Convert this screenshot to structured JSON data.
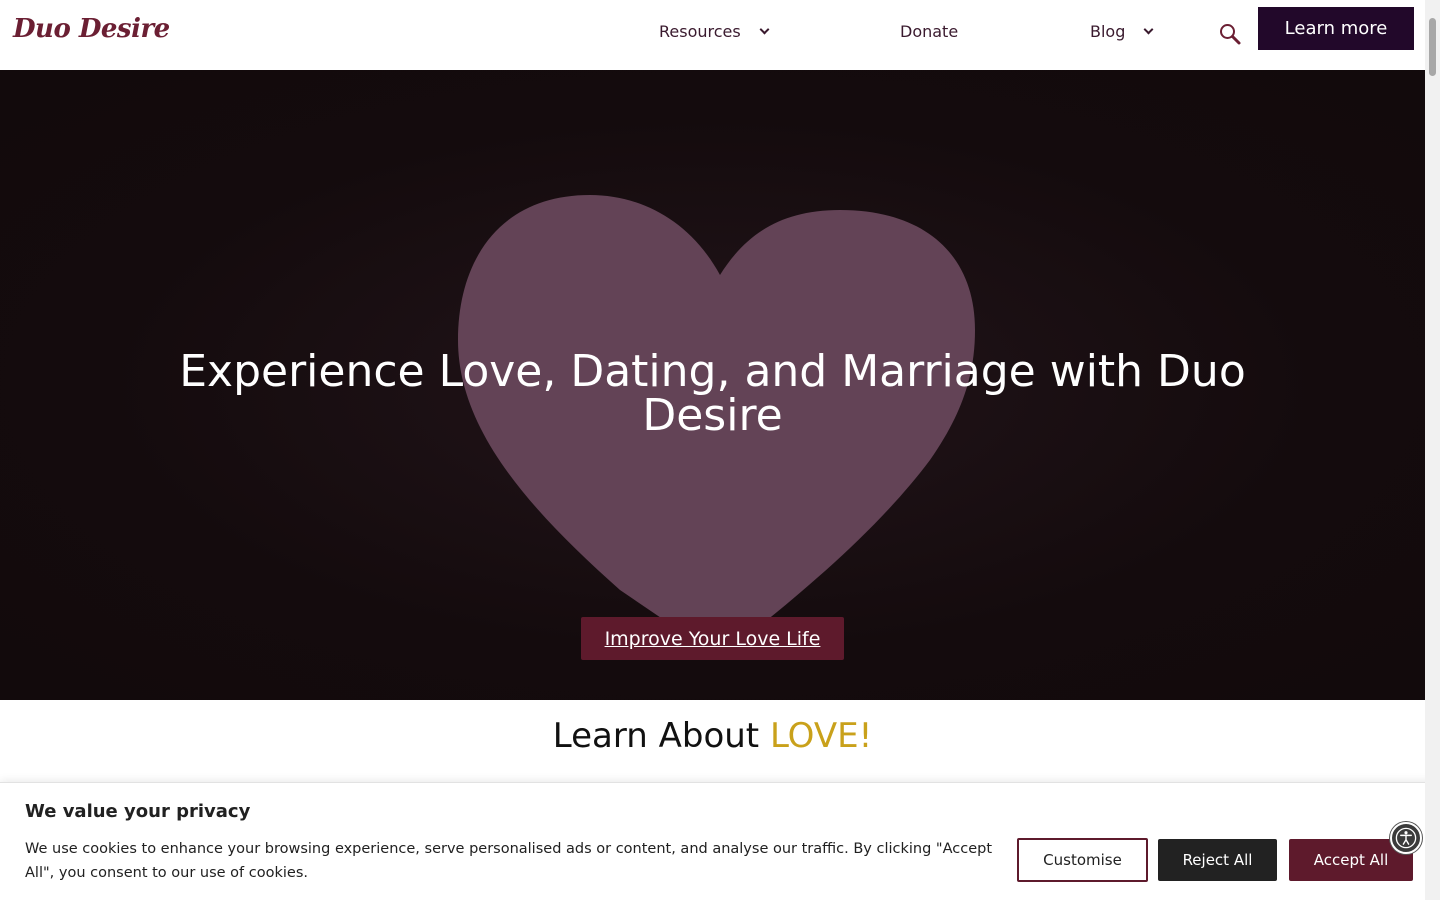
{
  "header": {
    "logo": "Duo Desire",
    "nav": {
      "resources": "Resources",
      "donate": "Donate",
      "blog": "Blog"
    },
    "search_icon": "search-icon",
    "learn_more": "Learn more"
  },
  "hero": {
    "title": "Experience Love, Dating, and Marriage with Duo Desire",
    "cta": "Improve Your Love Life"
  },
  "section": {
    "title_prefix": "Learn About ",
    "title_highlight": "LOVE!"
  },
  "cookie": {
    "title": "We value your privacy",
    "text": "We use cookies to enhance your browsing experience, serve personalised ads or content, and analyse our traffic. By clicking \"Accept All\", you consent to our use of cookies.",
    "customise": "Customise",
    "reject": "Reject All",
    "accept": "Accept All"
  },
  "colors": {
    "brand": "#5e1a2c",
    "dark": "#22082a",
    "highlight": "#c9a11b",
    "heart": "#634356"
  },
  "icons": [
    "search-icon",
    "chevron-down-icon",
    "heart-image",
    "accessibility-icon"
  ]
}
